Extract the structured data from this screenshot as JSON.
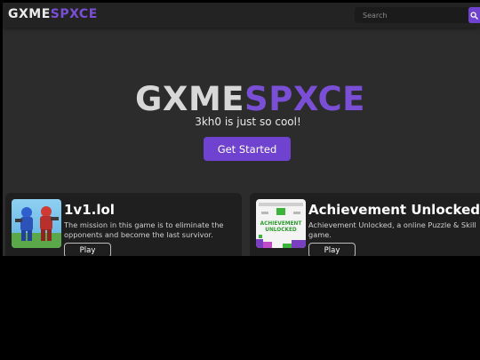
{
  "header": {
    "brand_part1": "GXME",
    "brand_part2": "SPXCE",
    "search_placeholder": "Search",
    "search_icon": "search-icon"
  },
  "hero": {
    "title_part1": "GXME",
    "title_part2": "SPXCE",
    "subtitle": "3kh0 is just so cool!",
    "cta_label": "Get Started"
  },
  "games": [
    {
      "title": "1v1.lol",
      "description": "The mission in this game is to eliminate the opponents and become the last survivor.",
      "play_label": "Play"
    },
    {
      "title": "Achievement Unlocked",
      "description": "Achievement Unlocked, a online Puzzle & Skill game.",
      "play_label": "Play",
      "thumb_text": "ACHIEVEMENT UNLOCKED"
    }
  ],
  "colors": {
    "accent": "#6f43cf",
    "brand_purple": "#7a4fd6",
    "background": "#2c2c2c",
    "card": "#1f1f1f",
    "topbar": "#232323"
  }
}
